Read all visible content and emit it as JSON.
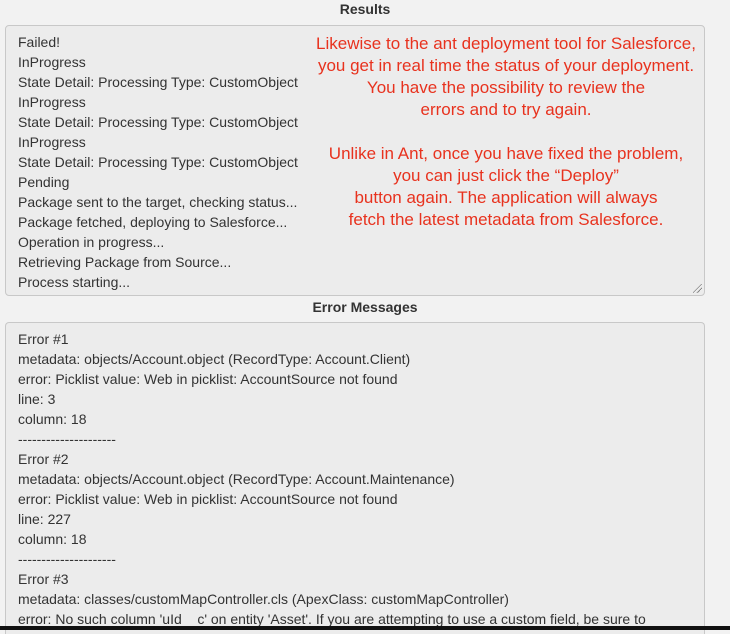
{
  "results": {
    "title": "Results",
    "lines": [
      "Failed!",
      "InProgress",
      "State Detail: Processing Type: CustomObject",
      "InProgress",
      "State Detail: Processing Type: CustomObject",
      "InProgress",
      "State Detail: Processing Type: CustomObject",
      "Pending",
      "Package sent to the target, checking status...",
      "Package fetched, deploying to Salesforce...",
      "Operation in progress...",
      "Retrieving Package from Source...",
      "Process starting..."
    ]
  },
  "annotation": {
    "color": "#e8321e",
    "paragraph1": [
      "Likewise to the ant deployment tool for Salesforce,",
      "you get in real time the status of your deployment.",
      "You have the possibility to review the",
      "errors and to try again."
    ],
    "paragraph2": [
      "Unlike in Ant, once you have fixed the problem,",
      "you can just click the “Deploy”",
      "button again. The application will always",
      "fetch the latest metadata from Salesforce."
    ]
  },
  "errors": {
    "title": "Error Messages",
    "lines": [
      "Error #1",
      "metadata: objects/Account.object (RecordType: Account.Client)",
      "error: Picklist value: Web in picklist: AccountSource not found",
      "line: 3",
      "column: 18",
      "---------------------",
      "Error #2",
      "metadata: objects/Account.object (RecordType: Account.Maintenance)",
      "error: Picklist value: Web in picklist: AccountSource not found",
      "line: 227",
      "column: 18",
      "---------------------",
      "Error #3",
      "metadata: classes/customMapController.cls (ApexClass: customMapController)",
      "error: No such column 'uId__c' on entity 'Asset'. If you are attempting to use a custom field, be sure to"
    ]
  }
}
